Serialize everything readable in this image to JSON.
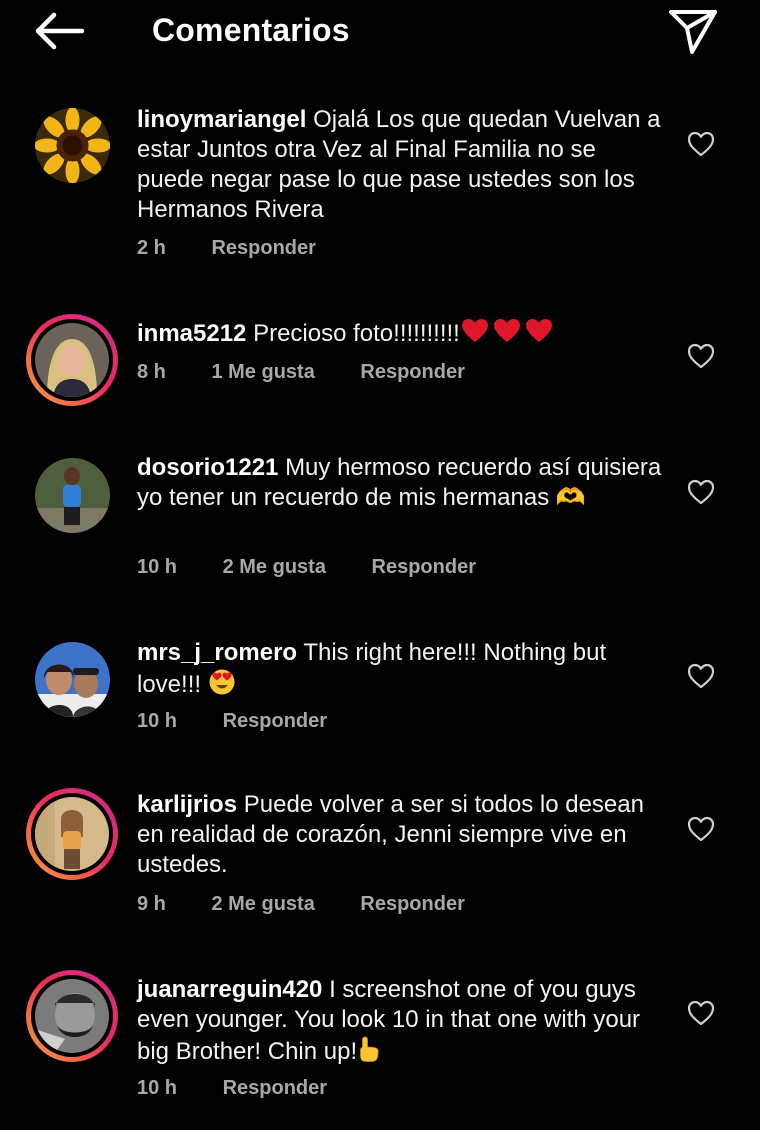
{
  "header": {
    "title": "Comentarios"
  },
  "comments": [
    {
      "username": "linoymariangel",
      "text": "Ojalá Los que quedan Vuelvan a estar Juntos otra Vez al Final Familia  no se puede negar pase lo que pase ustedes son los Hermanos Rivera",
      "time": "2 h",
      "likes": "",
      "reply": "Responder"
    },
    {
      "username": "inma5212",
      "text": "Precioso foto!!!!!!!!!!",
      "time": "8 h",
      "likes": "1 Me gusta",
      "reply": "Responder"
    },
    {
      "username": "dosorio1221",
      "text": "Muy hermoso recuerdo  así quisiera yo tener un recuerdo de mis hermanas 🫶",
      "time": "10 h",
      "likes": "2 Me gusta",
      "reply": "Responder"
    },
    {
      "username": "mrs_j_romero",
      "text": "This right here!!! Nothing but love!!!",
      "time": "10 h",
      "likes": "",
      "reply": "Responder"
    },
    {
      "username": "karlijrios",
      "text": "Puede volver a ser si todos lo desean en realidad de corazón, Jenni siempre vive en ustedes.",
      "time": "9 h",
      "likes": "2 Me gusta",
      "reply": "Responder"
    },
    {
      "username": "juanarreguin420",
      "text": "I screenshot one of you guys even younger. You look 10 in that one with your big Brother! Chin up!",
      "time": "10 h",
      "likes": "",
      "reply": "Responder"
    }
  ],
  "colors": {
    "background": "#000000",
    "text": "#ffffff",
    "meta": "#a8a8a8",
    "story_ring_start": "#f9a53a",
    "story_ring_end": "#c42f8f",
    "heart_emoji": "#e0162b"
  },
  "icons": {
    "back": "arrow-left-icon",
    "send": "paper-plane-icon",
    "like": "heart-outline-icon"
  }
}
